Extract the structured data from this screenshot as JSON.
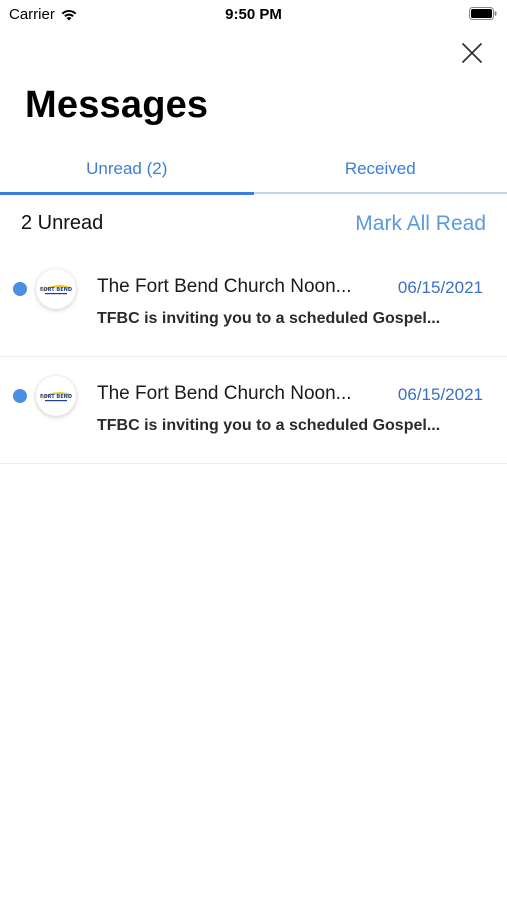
{
  "status_bar": {
    "carrier": "Carrier",
    "time": "9:50 PM"
  },
  "header": {
    "title": "Messages",
    "close_icon": "close-icon"
  },
  "tabs": [
    {
      "label": "Unread (2)",
      "active": true
    },
    {
      "label": "Received",
      "active": false
    }
  ],
  "toolbar": {
    "unread_count_label": "2 Unread",
    "mark_all_read_label": "Mark All Read"
  },
  "messages": [
    {
      "title": "The Fort Bend Church Noon...",
      "date": "06/15/2021",
      "preview": "TFBC is inviting you to a scheduled Gospel...",
      "unread": true,
      "avatar_logo_text": "FORT BEND"
    },
    {
      "title": "The Fort Bend Church Noon...",
      "date": "06/15/2021",
      "preview": "TFBC is inviting you to a scheduled Gospel...",
      "unread": true,
      "avatar_logo_text": "FORT BEND"
    }
  ],
  "colors": {
    "accent": "#3b7dd8",
    "mark_all_read": "#5a9be0",
    "unread_dot": "#4a90e2",
    "date": "#3b6fc4"
  }
}
